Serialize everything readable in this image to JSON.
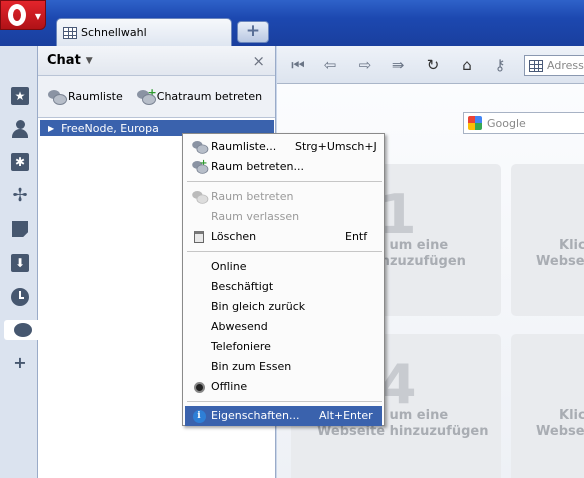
{
  "browser": {
    "tab_label": "Schnellwahl",
    "newtab_label": "+",
    "address_placeholder": "Adresse",
    "search_placeholder": "Google"
  },
  "panel": {
    "title": "Chat",
    "dropdown_arrow": "▼",
    "close": "×",
    "tools": [
      {
        "label": "Raumliste",
        "icon": "chat-bubbles-icon"
      },
      {
        "label": "Chatraum betreten",
        "icon": "chat-add-icon"
      }
    ],
    "tree_item": "FreeNode, Europa"
  },
  "menu": {
    "items": [
      {
        "label": "Raumliste...",
        "shortcut": "Strg+Umsch+J",
        "enabled": true
      },
      {
        "label": "Raum betreten...",
        "shortcut": "",
        "enabled": true
      },
      {
        "label": "Raum betreten",
        "shortcut": "",
        "enabled": false
      },
      {
        "label": "Raum verlassen",
        "shortcut": "",
        "enabled": false
      },
      {
        "label": "Löschen",
        "shortcut": "Entf",
        "enabled": true
      },
      {
        "label": "Online",
        "shortcut": "",
        "enabled": true
      },
      {
        "label": "Beschäftigt",
        "shortcut": "",
        "enabled": true
      },
      {
        "label": "Bin gleich zurück",
        "shortcut": "",
        "enabled": true
      },
      {
        "label": "Abwesend",
        "shortcut": "",
        "enabled": true
      },
      {
        "label": "Telefoniere",
        "shortcut": "",
        "enabled": true
      },
      {
        "label": "Bin zum Essen",
        "shortcut": "",
        "enabled": true
      },
      {
        "label": "Offline",
        "shortcut": "",
        "enabled": true,
        "selected": true
      },
      {
        "label": "Eigenschaften...",
        "shortcut": "Alt+Enter",
        "enabled": true,
        "highlighted": true
      }
    ]
  },
  "speeddial": {
    "tiles": [
      {
        "number": "1",
        "text1": ", um eine",
        "text2": "hinzuzufügen"
      },
      {
        "number": "",
        "text1": "Klick",
        "text2": "Webseit"
      },
      {
        "number": "4",
        "text1": ", um eine",
        "text2": "Webseite hinzuzufügen"
      },
      {
        "number": "",
        "text1": "Klick",
        "text2": "Webseit"
      }
    ]
  }
}
